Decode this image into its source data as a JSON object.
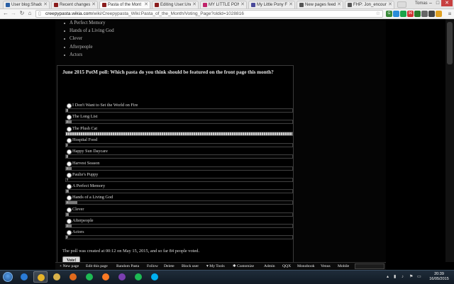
{
  "browser": {
    "tabs": [
      {
        "title": "User blog:Shadow",
        "favicon_color": "#2a5fa5",
        "active": false
      },
      {
        "title": "Recent changes",
        "favicon_color": "#8a1d1d",
        "active": false
      },
      {
        "title": "Pasta of the Mont",
        "favicon_color": "#8a1d1d",
        "active": true
      },
      {
        "title": "Editing User:Undi",
        "favicon_color": "#8a1d1d",
        "active": false
      },
      {
        "title": "MY LITTLE PONY",
        "favicon_color": "#c0246a",
        "active": false
      },
      {
        "title": "My Little Pony Fri",
        "favicon_color": "#4a4a9a",
        "active": false
      },
      {
        "title": "New pages feed",
        "favicon_color": "#555555",
        "active": false
      },
      {
        "title": "FHP: Jon_encoun",
        "favicon_color": "#555555",
        "active": false
      }
    ],
    "user_name": "Tomas",
    "window_buttons": {
      "minimize": "–",
      "maximize": "□",
      "close": "✕"
    },
    "url_host": "creepypasta.wikia.com",
    "url_path": "/wiki/Creepypasta_Wiki:Pasta_of_the_Month/Voting_Page?oldid=1028816",
    "extensions": [
      {
        "icon": "g-extension-icon",
        "label": "G",
        "color": "#3a8a3a"
      },
      {
        "icon": "circle-extension-icon",
        "label": "",
        "color": "#2a8bd8"
      },
      {
        "icon": "dot-extension-icon",
        "label": "",
        "color": "#1ba34a"
      },
      {
        "icon": "badge-extension-icon",
        "label": "96",
        "color": "#d03030"
      },
      {
        "icon": "shield-extension-icon",
        "label": "",
        "color": "#2a7a2a"
      },
      {
        "icon": "person-extension-icon",
        "label": "",
        "color": "#666666"
      },
      {
        "icon": "mail-extension-icon",
        "label": "",
        "color": "#444444"
      },
      {
        "icon": "puzzle-extension-icon",
        "label": "",
        "color": "#e0a020"
      }
    ]
  },
  "previous_winners": [
    "A Perfect Memory",
    "Hands of a Living God",
    "Clever",
    "Afterpeople",
    "Actors"
  ],
  "poll": {
    "question": "June 2015 PotM poll: Which pasta do you think should be featured on the front page this month?",
    "options": [
      {
        "label": "I Don't Want to Set the World on Fire",
        "votes": 1,
        "share": 0.01
      },
      {
        "label": "The Long List",
        "votes": 2,
        "share": 0.024
      },
      {
        "label": "The Plush Cat",
        "votes": 62,
        "share": 1.0
      },
      {
        "label": "Hospital Food",
        "votes": 1,
        "share": 0.006
      },
      {
        "label": "Happy Sun Daycare",
        "votes": 1,
        "share": 0.01
      },
      {
        "label": "Harvest Season",
        "votes": 2,
        "share": 0.024
      },
      {
        "label": "Paulie's Puppy",
        "votes": 0,
        "share": 0.0
      },
      {
        "label": "A Perfect Memory",
        "votes": 3,
        "share": 0.013
      },
      {
        "label": "Hands of a Living God",
        "votes": 4,
        "share": 0.05
      },
      {
        "label": "Clever",
        "votes": 1,
        "share": 0.013
      },
      {
        "label": "Afterpeople",
        "votes": 2,
        "share": 0.024
      },
      {
        "label": "Actors",
        "votes": 5,
        "share": 0.006
      }
    ],
    "footer": "The poll was created at 00:12 on May 15, 2015, and so far 84 people voted.",
    "vote_label": "Vote!"
  },
  "wiki_toolbar": {
    "items": [
      "New page",
      "Edit this page",
      "Random Pasta",
      "Follow",
      "Delete",
      "Block user",
      "My Tools",
      "Customize",
      "Admin",
      "QQX",
      "Monobook",
      "Venus",
      "Mobile"
    ]
  },
  "taskbar": {
    "apps": [
      {
        "icon": "internet-explorer-icon",
        "color": "#2a7bd6",
        "active": false
      },
      {
        "icon": "chrome-icon",
        "color": "#e6b428",
        "active": true
      },
      {
        "icon": "file-explorer-icon",
        "color": "#d8b24a",
        "active": false
      },
      {
        "icon": "firefox-icon",
        "color": "#e06a1c",
        "active": false
      },
      {
        "icon": "spotify-icon",
        "color": "#1db954",
        "active": false
      },
      {
        "icon": "xampp-icon",
        "color": "#fb7a24",
        "active": false
      },
      {
        "icon": "visual-studio-icon",
        "color": "#7a3fb0",
        "active": false
      },
      {
        "icon": "spotify-icon-2",
        "color": "#1db954",
        "active": false
      },
      {
        "icon": "skype-icon",
        "color": "#00aff0",
        "active": false
      }
    ],
    "time": "20:39",
    "date": "16/05/2015"
  }
}
